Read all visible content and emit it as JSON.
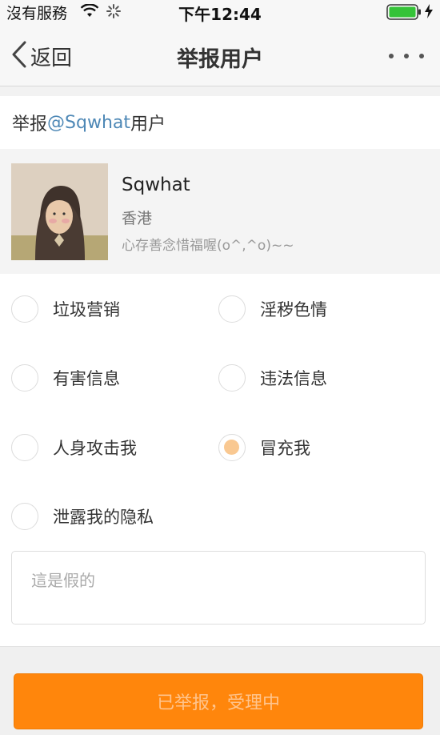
{
  "status_bar": {
    "carrier": "沒有服務",
    "time": "下午12:44",
    "icons": [
      "wifi-icon",
      "activity-icon",
      "battery-icon",
      "charging-icon"
    ]
  },
  "nav": {
    "back_label": "返回",
    "title": "举报用户",
    "more_icon": "more-icon"
  },
  "report": {
    "prefix": "举报",
    "mention": "@Sqwhat",
    "suffix": "用户"
  },
  "user": {
    "name": "Sqwhat",
    "location": "香港",
    "bio": "心存善念惜福喔(o^,^o)~~"
  },
  "options": [
    {
      "label": "垃圾营销",
      "checked": false
    },
    {
      "label": "淫秽色情",
      "checked": false
    },
    {
      "label": "有害信息",
      "checked": false
    },
    {
      "label": "违法信息",
      "checked": false
    },
    {
      "label": "人身攻击我",
      "checked": false
    },
    {
      "label": "冒充我",
      "checked": true
    },
    {
      "label": "泄露我的隐私",
      "checked": false
    }
  ],
  "description": {
    "value": "這是假的"
  },
  "submit": {
    "label": "已举报，受理中"
  },
  "colors": {
    "accent": "#ff860c",
    "mention": "#4e88b6",
    "radio_selected": "#f9c891"
  }
}
